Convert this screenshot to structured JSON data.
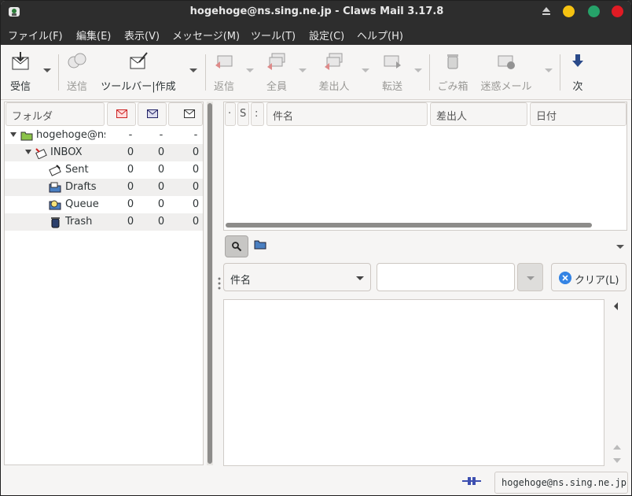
{
  "window": {
    "title": "hogehoge@ns.sing.ne.jp - Claws Mail 3.17.8"
  },
  "menubar": {
    "items": [
      "ファイル(F)",
      "編集(E)",
      "表示(V)",
      "メッセージ(M)",
      "ツール(T)",
      "設定(C)",
      "ヘルプ(H)"
    ]
  },
  "toolbar": {
    "receive": "受信",
    "send": "送信",
    "compose": "ツールバー|作成",
    "reply": "返信",
    "reply_all": "全員",
    "reply_sender": "差出人",
    "forward": "転送",
    "trash": "ごみ箱",
    "spam": "迷惑メール",
    "next": "次"
  },
  "folders": {
    "header": "フォルダ",
    "rows": [
      {
        "name": "hogehoge@ns",
        "new": "-",
        "unread": "-",
        "total": "-"
      },
      {
        "name": "INBOX",
        "new": "0",
        "unread": "0",
        "total": "0"
      },
      {
        "name": "Sent",
        "new": "0",
        "unread": "0",
        "total": "0"
      },
      {
        "name": "Drafts",
        "new": "0",
        "unread": "0",
        "total": "0"
      },
      {
        "name": "Queue",
        "new": "0",
        "unread": "0",
        "total": "0"
      },
      {
        "name": "Trash",
        "new": "0",
        "unread": "0",
        "total": "0"
      }
    ]
  },
  "message_list": {
    "columns": {
      "c1": "·",
      "c2": "S",
      "c3": ":",
      "subject": "件名",
      "from": "差出人",
      "date": "日付"
    }
  },
  "search": {
    "field_type": "件名",
    "clear_label": "クリア(L)"
  },
  "statusbar": {
    "account": "hogehoge@ns.sing.ne.jp"
  },
  "colors": {
    "titlebar_bg": "#2d2d2d",
    "window_bg": "#f6f5f4",
    "minimize": "#f5c211",
    "maximize": "#26a269",
    "close": "#e01b24"
  }
}
